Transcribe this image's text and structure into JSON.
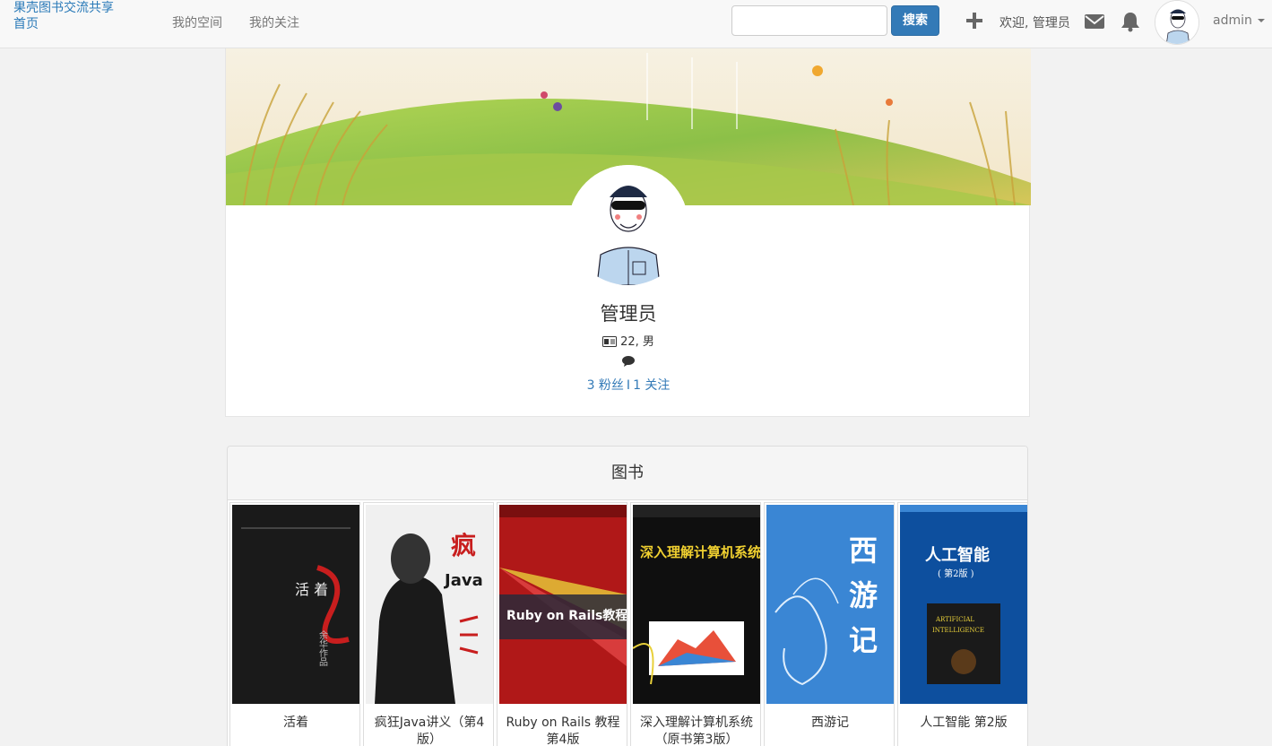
{
  "navbar": {
    "brand_line1": "果壳图书交流共享",
    "brand_line2": "首页",
    "links": [
      "我的空间",
      "我的关注"
    ],
    "search_placeholder": "",
    "search_label": "搜索",
    "welcome": "欢迎, 管理员",
    "user": "admin"
  },
  "profile": {
    "name": "管理员",
    "meta": "22, 男",
    "followers": "3 粉丝",
    "separator": "I",
    "following": "1 关注"
  },
  "books_panel": {
    "title": "图书",
    "books": [
      {
        "title": "活着",
        "cover_color": "#1a1a1a",
        "cover_text": "活着"
      },
      {
        "title": "疯狂Java讲义（第4版）",
        "cover_color": "#eeeeee",
        "cover_text": "疯狂Java讲义"
      },
      {
        "title": "Ruby on Rails 教程 第4版",
        "cover_color": "#c81e1e",
        "cover_text": "Ruby on Rails教程"
      },
      {
        "title": "深入理解计算机系统（原书第3版）",
        "cover_color": "#111111",
        "cover_text": "深入理解计算机系统"
      },
      {
        "title": "西游记",
        "cover_color": "#3a86d4",
        "cover_text": "西游记"
      },
      {
        "title": "人工智能 第2版",
        "cover_color": "#0d4f9e",
        "cover_text": "人工智能"
      }
    ]
  }
}
